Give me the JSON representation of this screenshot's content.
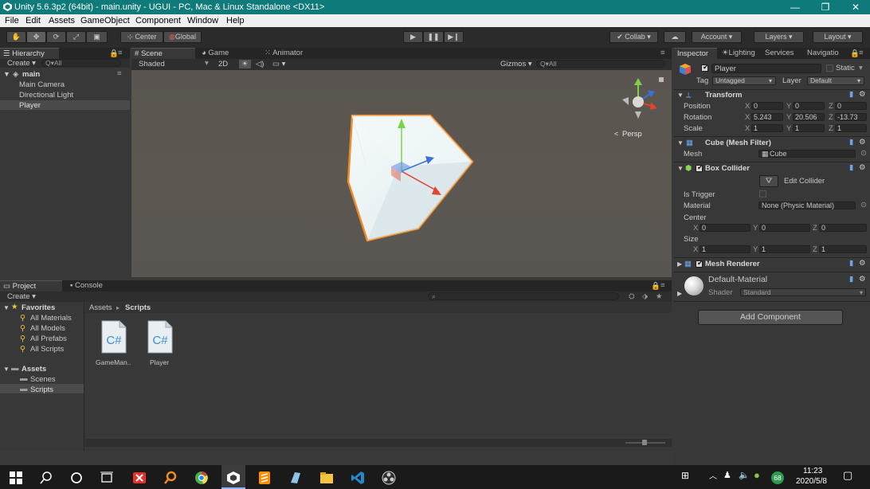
{
  "window": {
    "title": "Unity 5.6.3p2 (64bit) - main.unity - UGUI - PC, Mac & Linux Standalone <DX11>",
    "minimize": "—",
    "maximize": "❐",
    "close": "✕"
  },
  "menu": [
    "File",
    "Edit",
    "Assets",
    "GameObject",
    "Component",
    "Window",
    "Help"
  ],
  "toolbar": {
    "pivot": "Center",
    "space": "Global",
    "collab": "Collab",
    "account": "Account",
    "layers": "Layers",
    "layout": "Layout"
  },
  "hierarchy": {
    "tab": "Hierarchy",
    "create": "Create",
    "search_placeholder": "Q▾All",
    "scene": "main",
    "items": [
      "Main Camera",
      "Directional Light",
      "Player"
    ]
  },
  "scene_view": {
    "tabs": [
      "Scene",
      "Game",
      "Animator"
    ],
    "shading": "Shaded",
    "mode_2d": "2D",
    "gizmos": "Gizmos",
    "search_placeholder": "Q▾All",
    "persp": "Persp"
  },
  "inspector": {
    "tabs": [
      "Inspector",
      "Lighting",
      "Services",
      "Navigatio"
    ],
    "object_name": "Player",
    "static_label": "Static",
    "tag_label": "Tag",
    "tag_value": "Untagged",
    "layer_label": "Layer",
    "layer_value": "Default",
    "transform": {
      "title": "Transform",
      "position_label": "Position",
      "rotation_label": "Rotation",
      "scale_label": "Scale",
      "position": {
        "x": "0",
        "y": "0",
        "z": "0"
      },
      "rotation": {
        "x": "5.243",
        "y": "20.506",
        "z": "-13.73"
      },
      "scale": {
        "x": "1",
        "y": "1",
        "z": "1"
      }
    },
    "mesh_filter": {
      "title": "Cube (Mesh Filter)",
      "mesh_label": "Mesh",
      "mesh_value": "Cube"
    },
    "box_collider": {
      "title": "Box Collider",
      "edit_collider": "Edit Collider",
      "is_trigger_label": "Is Trigger",
      "material_label": "Material",
      "material_value": "None (Physic Material)",
      "center_label": "Center",
      "center": {
        "x": "0",
        "y": "0",
        "z": "0"
      },
      "size_label": "Size",
      "size": {
        "x": "1",
        "y": "1",
        "z": "1"
      }
    },
    "mesh_renderer": {
      "title": "Mesh Renderer"
    },
    "material": {
      "name": "Default-Material",
      "shader_label": "Shader",
      "shader_value": "Standard"
    },
    "add_component": "Add Component"
  },
  "project": {
    "tabs": [
      "Project",
      "Console"
    ],
    "create": "Create",
    "favorites": "Favorites",
    "favorite_items": [
      "All Materials",
      "All Models",
      "All Prefabs",
      "All Scripts"
    ],
    "assets": "Assets",
    "asset_folders": [
      "Scenes",
      "Scripts"
    ],
    "breadcrumb": [
      "Assets",
      "Scripts"
    ],
    "files": [
      "GameMan..",
      "Player"
    ]
  },
  "taskbar": {
    "time": "11:23",
    "date": "2020/5/8",
    "badge": "68"
  },
  "colors": {
    "titlebar": "#0e7a7a",
    "selection": "#4b4b4b",
    "cube_outline": "#f08a24"
  }
}
